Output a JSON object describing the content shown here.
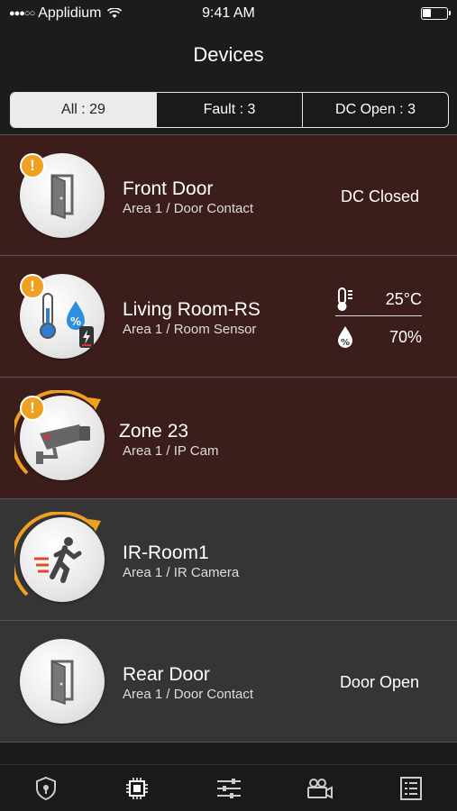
{
  "status_bar": {
    "carrier": "Applidium",
    "time": "9:41 AM"
  },
  "nav": {
    "title": "Devices"
  },
  "filters": [
    {
      "label": "All : 29",
      "active": true
    },
    {
      "label": "Fault : 3",
      "active": false
    },
    {
      "label": "DC Open : 3",
      "active": false
    }
  ],
  "devices": [
    {
      "name": "Front Door",
      "subtitle": "Area 1 / Door Contact",
      "status": "DC Closed",
      "icon": "door-icon",
      "fault": true
    },
    {
      "name": "Living Room-RS",
      "subtitle": "Area 1 / Room Sensor",
      "temperature": "25°C",
      "humidity": "70%",
      "icon": "thermometer-humidity-icon",
      "fault": true
    },
    {
      "name": "Zone 23",
      "subtitle": "Area 1 / IP Cam",
      "icon": "security-camera-icon",
      "fault": true
    },
    {
      "name": "IR-Room1",
      "subtitle": "Area 1 / IR Camera",
      "icon": "running-person-icon",
      "fault": false
    },
    {
      "name": "Rear Door",
      "subtitle": "Area 1 / Door Contact",
      "status": "Door Open",
      "icon": "door-icon",
      "fault": false
    }
  ],
  "tabbar": [
    "shield-lock-icon",
    "chip-icon",
    "sliders-icon",
    "video-camera-icon",
    "list-icon"
  ],
  "colors": {
    "fault_row": "#3b1d1b",
    "normal_row": "#353535",
    "alert": "#f0a020",
    "active_segment": "#ececec"
  }
}
